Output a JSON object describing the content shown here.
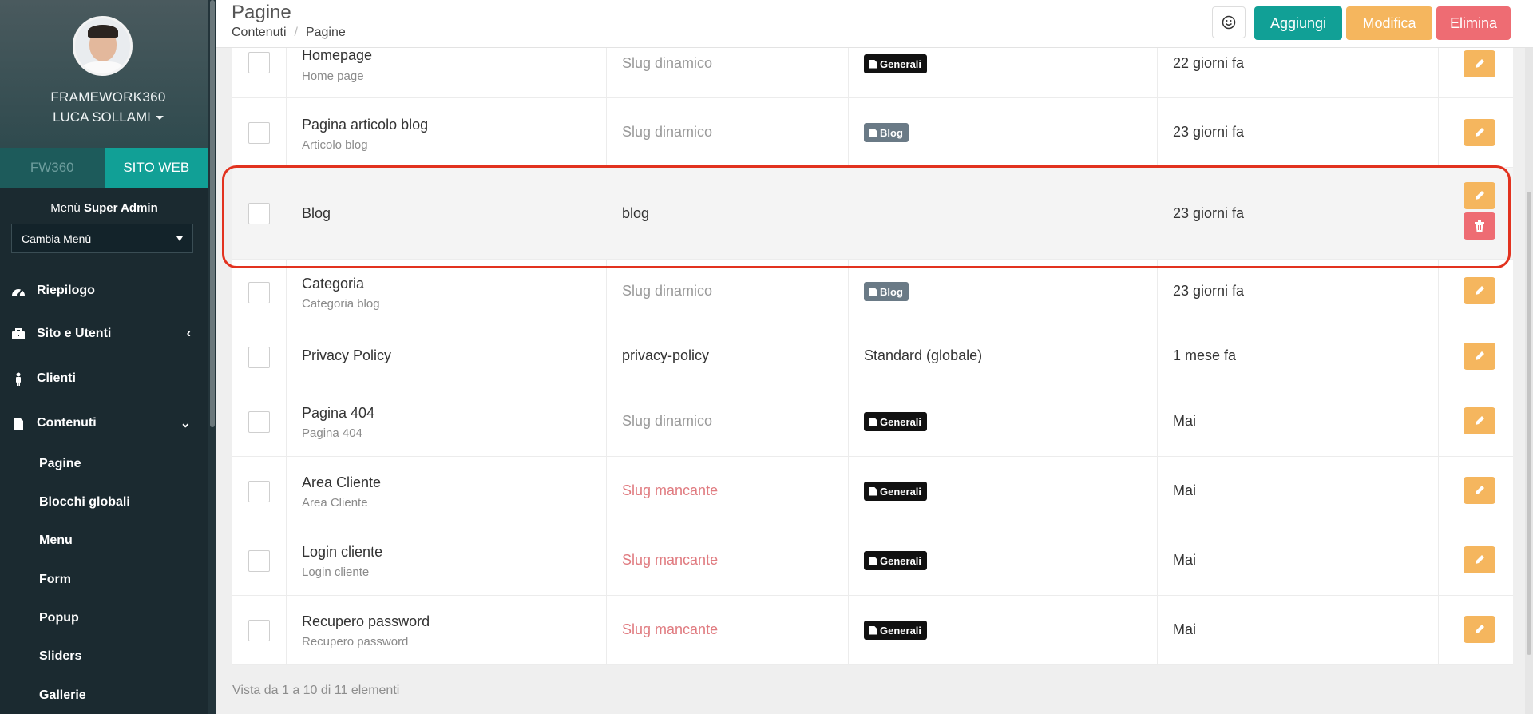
{
  "sidebar": {
    "org_name": "FRAMEWORK360",
    "user_name": "LUCA SOLLAMI",
    "tabs": [
      {
        "label": "FW360",
        "active": false
      },
      {
        "label": "SITO WEB",
        "active": true
      }
    ],
    "menu_prefix": "Menù",
    "menu_role": "Super Admin",
    "menu_select": "Cambia Menù",
    "nav": [
      {
        "label": "Riepilogo",
        "icon": "dashboard-icon"
      },
      {
        "label": "Sito e Utenti",
        "icon": "briefcase-icon",
        "chevron": "‹"
      },
      {
        "label": "Clienti",
        "icon": "person-icon"
      },
      {
        "label": "Contenuti",
        "icon": "file-icon",
        "chevron": "⌄"
      }
    ],
    "subnav": [
      "Pagine",
      "Blocchi globali",
      "Menu",
      "Form",
      "Popup",
      "Sliders",
      "Gallerie"
    ]
  },
  "header": {
    "title": "Pagine",
    "breadcrumb": [
      "Contenuti",
      "Pagine"
    ],
    "buttons": {
      "add": "Aggiungi",
      "edit": "Modifica",
      "delete": "Elimina"
    }
  },
  "rows": [
    {
      "title": "Homepage",
      "subtitle": "Home page",
      "slug": "Slug dinamico",
      "template": "Generali",
      "date": "22 giorni fa"
    },
    {
      "title": "Pagina articolo blog",
      "subtitle": "Articolo blog",
      "slug": "Slug dinamico",
      "template": "Blog",
      "date": "23 giorni fa"
    },
    {
      "title": "Blog",
      "subtitle": "",
      "slug": "blog",
      "template": "",
      "date": "23 giorni fa"
    },
    {
      "title": "Categoria",
      "subtitle": "Categoria blog",
      "slug": "Slug dinamico",
      "template": "Blog",
      "date": "23 giorni fa"
    },
    {
      "title": "Privacy Policy",
      "subtitle": "",
      "slug": "privacy-policy",
      "template": "Standard (globale)",
      "date": "1 mese fa"
    },
    {
      "title": "Pagina 404",
      "subtitle": "Pagina 404",
      "slug": "Slug dinamico",
      "template": "Generali",
      "date": "Mai"
    },
    {
      "title": "Area Cliente",
      "subtitle": "Area Cliente",
      "slug": "Slug mancante",
      "template": "Generali",
      "date": "Mai"
    },
    {
      "title": "Login cliente",
      "subtitle": "Login cliente",
      "slug": "Slug mancante",
      "template": "Generali",
      "date": "Mai"
    },
    {
      "title": "Recupero password",
      "subtitle": "Recupero password",
      "slug": "Slug mancante",
      "template": "Generali",
      "date": "Mai"
    }
  ],
  "footer": {
    "info": "Vista da 1 a 10 di 11 elementi"
  },
  "colors": {
    "accent": "#11a096",
    "edit": "#f5b65e",
    "delete": "#ee6c73",
    "sidebar": "#1b2a30",
    "highlight": "#e2321f"
  }
}
